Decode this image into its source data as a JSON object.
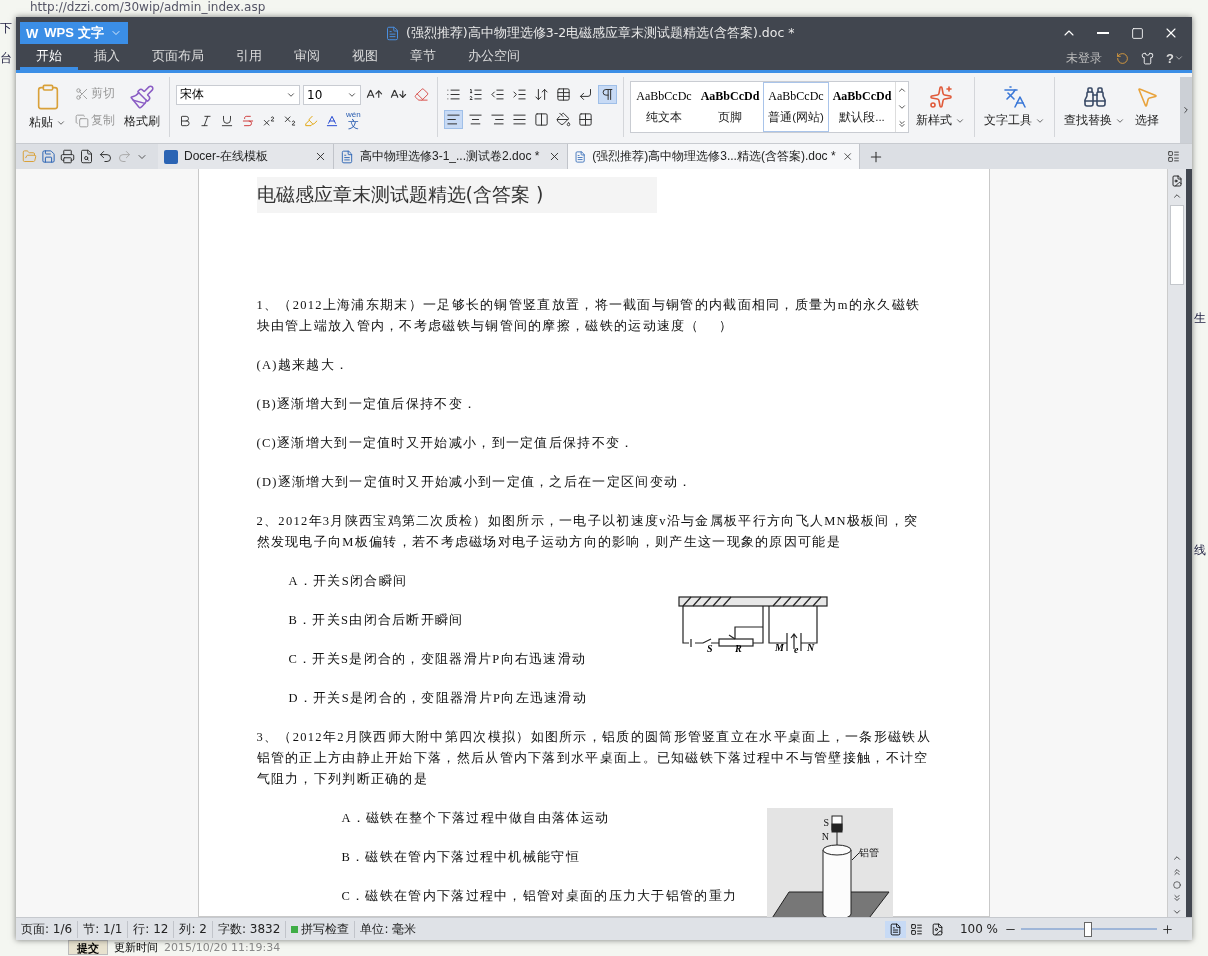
{
  "browser": {
    "url": "http://dzzi.com/30wip/admin_index.asp",
    "left_fragments": [
      "下",
      "台"
    ],
    "right_fragments": [
      "生",
      "线"
    ],
    "submit": "提交",
    "updated_label": "更新时间",
    "updated_value": "2015/10/20 11:19:34"
  },
  "window": {
    "app_logo": "W",
    "app_button": "WPS 文字",
    "title": "(强烈推荐)高中物理选修3-2电磁感应章末测试题精选(含答案).doc *"
  },
  "menu_tabs": [
    {
      "label": "开始",
      "selected": true
    },
    {
      "label": "插入",
      "selected": false
    },
    {
      "label": "页面布局",
      "selected": false
    },
    {
      "label": "引用",
      "selected": false
    },
    {
      "label": "审阅",
      "selected": false
    },
    {
      "label": "视图",
      "selected": false
    },
    {
      "label": "章节",
      "selected": false
    },
    {
      "label": "办公空间",
      "selected": false
    }
  ],
  "account": {
    "login": "未登录",
    "help": "?"
  },
  "ribbon": {
    "paste": "粘贴",
    "cut": {
      "label": "剪切",
      "disabled": true
    },
    "copy": {
      "label": "复制",
      "disabled": true
    },
    "format_painter": "格式刷",
    "font_name": "宋体",
    "font_size": "10",
    "phonetic": {
      "pinyin": "wén",
      "char": "文"
    },
    "alignment": [
      {
        "selected": true
      },
      {
        "selected": false
      },
      {
        "selected": false
      },
      {
        "selected": false
      },
      {
        "selected": false
      }
    ],
    "show_marks": {
      "selected": true
    },
    "styles": [
      {
        "sample": "AaBbCcDc",
        "label": "纯文本",
        "selected": false
      },
      {
        "sample": "AaBbCcDd",
        "label": "页脚",
        "selected": false
      },
      {
        "sample": "AaBbCcDc",
        "label": "普通(网站)",
        "selected": true
      },
      {
        "sample": "AaBbCcDd",
        "label": "默认段...",
        "selected": false
      }
    ],
    "new_style": "新样式",
    "text_tools": "文字工具",
    "find_replace": "查找替换",
    "select": "选择"
  },
  "doc_tabs": [
    {
      "label": "Docer-在线模板",
      "kind": "docer",
      "selected": false
    },
    {
      "label": "高中物理选修3-1_...测试卷2.doc *",
      "kind": "word",
      "selected": false
    },
    {
      "label": "(强烈推荐)高中物理选修3...精选(含答案).doc *",
      "kind": "word",
      "selected": true
    }
  ],
  "document": {
    "heading": "电磁感应章末测试题精选(含答案 )",
    "blocks": [
      {
        "kind": "para",
        "text": "1、（2012上海浦东期末）一足够长的铜管竖直放置，将一截面与铜管的内截面相同，质量为m的永久磁铁块由管上端放入管内，不考虑磁铁与铜管间的摩擦，磁铁的运动速度（　 ）"
      },
      {
        "kind": "para",
        "text": "(A)越来越大．"
      },
      {
        "kind": "para",
        "text": "(B)逐渐增大到一定值后保持不变．"
      },
      {
        "kind": "para",
        "text": "(C)逐渐增大到一定值时又开始减小，到一定值后保持不变．"
      },
      {
        "kind": "para",
        "text": "(D)逐渐增大到一定值时又开始减小到一定值，之后在一定区间变动．"
      },
      {
        "kind": "para",
        "text": "2、2012年3月陕西宝鸡第二次质检）如图所示，一电子以初速度v沿与金属板平行方向飞人MN极板间，突然发现电子向M板偏转，若不考虑磁场对电子运动方向的影响，则产生这一现象的原因可能是"
      },
      {
        "kind": "options",
        "items": [
          "A．开关S闭合瞬间",
          "B．开关S由闭合后断开瞬间",
          "C．开关S是闭合的，变阻器滑片P向右迅速滑动",
          "D．开关S是闭合的，变阻器滑片P向左迅速滑动"
        ],
        "figure": {
          "kind": "circuit",
          "labels": [
            "S",
            "R",
            "M",
            "e",
            "N"
          ]
        }
      },
      {
        "kind": "para",
        "text": "3、（2012年2月陕西师大附中第四次模拟）如图所示，铝质的圆筒形管竖直立在水平桌面上，一条形磁铁从铝管的正上方由静止开始下落，然后从管内下落到水平桌面上。已知磁铁下落过程中不与管壁接触，不计空气阻力，下列判断正确的是"
      },
      {
        "kind": "options",
        "items": [
          "A．磁铁在整个下落过程中做自由落体运动",
          "B．磁铁在管内下落过程中机械能守恒",
          "C．磁铁在管内下落过程中，铝管对桌面的压力大于铝管的重力"
        ],
        "figure": {
          "kind": "tube",
          "labels": [
            "S",
            "N",
            "铝管"
          ]
        }
      }
    ]
  },
  "status_bar": {
    "page": "页面: 1/6",
    "section": "节: 1/1",
    "row": "行: 12",
    "col": "列: 2",
    "words": "字数: 3832",
    "spell": "拼写检查",
    "unit": "单位: 毫米",
    "zoom": "100 %",
    "zoom_slider": {
      "level": 0.49
    }
  }
}
